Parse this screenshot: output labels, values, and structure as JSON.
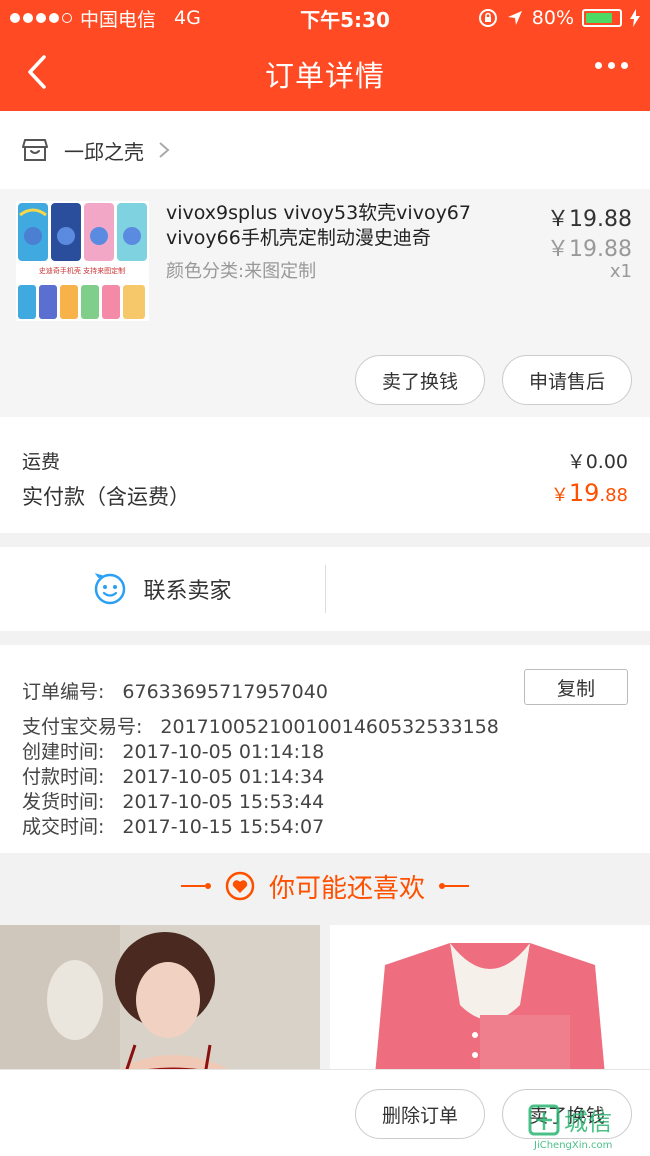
{
  "status_bar": {
    "carrier": "中国电信",
    "network": "4G",
    "time": "下午5:30",
    "battery": "80%",
    "battery_level": 0.8
  },
  "nav": {
    "title": "订单详情"
  },
  "shop": {
    "name": "一邱之壳"
  },
  "item": {
    "title": "vivox9splus vivoy53软壳vivoy67 vivoy66手机壳定制动漫史迪奇",
    "sku": "颜色分类:来图定制",
    "price": "￥19.88",
    "original_price": "￥19.88",
    "quantity": "x1",
    "thumb_caption": "史迪奇手机壳 支持来图定制",
    "actions": [
      "卖了换钱",
      "申请售后"
    ]
  },
  "fees": {
    "shipping_label": "运费",
    "shipping_value": "￥0.00",
    "total_label": "实付款（含运费）",
    "total_currency": "￥",
    "total_int": "19",
    "total_dec": ".88"
  },
  "contact": {
    "label": "联系卖家"
  },
  "order_info": {
    "copy_label": "复制",
    "rows": [
      {
        "label": "订单编号:",
        "value": "67633695717957040"
      },
      {
        "label": "支付宝交易号:",
        "value": "2017100521001001460532533158"
      },
      {
        "label": "创建时间:",
        "value": "2017-10-05 01:14:18"
      },
      {
        "label": "付款时间:",
        "value": "2017-10-05 01:14:34"
      },
      {
        "label": "发货时间:",
        "value": "2017-10-05 15:53:44"
      },
      {
        "label": "成交时间:",
        "value": "2017-10-15 15:54:07"
      }
    ]
  },
  "recommend": {
    "title": "你可能还喜欢"
  },
  "bottom_bar": {
    "buttons": [
      "删除订单",
      "卖了换钱"
    ]
  },
  "watermark": {
    "text": "城信",
    "sub": "JiChengXin.com"
  },
  "colors": {
    "brand": "#ff4a23",
    "price_accent": "#ff5000",
    "contact_icon": "#2aa0f5"
  }
}
